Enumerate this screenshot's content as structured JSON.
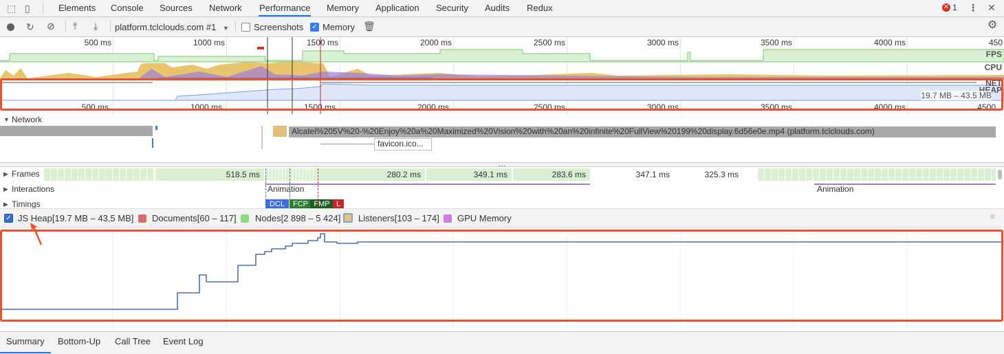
{
  "tabs": {
    "items": [
      "Elements",
      "Console",
      "Sources",
      "Network",
      "Performance",
      "Memory",
      "Application",
      "Security",
      "Audits",
      "Redux"
    ],
    "active": "Performance",
    "error_count": "1"
  },
  "toolbar": {
    "profile_select": "platform.tclclouds.com #1",
    "screenshots_label": "Screenshots",
    "screenshots_checked": false,
    "memory_label": "Memory",
    "memory_checked": true
  },
  "overview": {
    "ticks": [
      "500 ms",
      "1000 ms",
      "1500 ms",
      "2000 ms",
      "2500 ms",
      "3000 ms",
      "3500 ms",
      "4000 ms",
      "450"
    ],
    "track_fps": "FPS",
    "track_cpu": "CPU",
    "track_net": "NET",
    "track_heap": "HEAP",
    "heap_range": "19.7 MB – 43.5 MB",
    "bottom_ticks": [
      "500 ms",
      "1000 ms",
      "1500 ms",
      "2000 ms",
      "2500 ms",
      "3000 ms",
      "3500 ms",
      "4000 ms",
      "4500"
    ]
  },
  "network": {
    "label": "Network",
    "request_main": "Alcatel%205V%20-%20Enjoy%20a%20Maximized%20Vision%20with%20an%20infinite%20FullView%20199%20display.6d56e0e.mp4 (platform.tclclouds.com)",
    "request_favicon": "favicon.ico..."
  },
  "frames": {
    "label": "Frames",
    "durations": [
      "518.5 ms",
      "280.2 ms",
      "349.1 ms",
      "283.6 ms",
      "347.1 ms",
      "325.3 ms"
    ]
  },
  "interactions": {
    "label": "Interactions",
    "animations": [
      "Animation",
      "Animation"
    ]
  },
  "timings": {
    "label": "Timings",
    "badges": [
      "DCL",
      "FCP",
      "FMP",
      "L"
    ]
  },
  "legend": {
    "js_heap": "JS Heap[19.7 MB – 43.5 MB]",
    "documents": "Documents[60 – 117]",
    "nodes": "Nodes[2 898 – 5 424]",
    "listeners": "Listeners[103 – 174]",
    "gpu": "GPU Memory",
    "colors": {
      "js_heap": "#3b6fd4",
      "documents": "#d96c6c",
      "nodes": "#8ed883",
      "listeners": "#e6c475",
      "gpu": "#d07fe0"
    }
  },
  "bottom_tabs": {
    "items": [
      "Summary",
      "Bottom-Up",
      "Call Tree",
      "Event Log"
    ],
    "active": "Summary"
  }
}
